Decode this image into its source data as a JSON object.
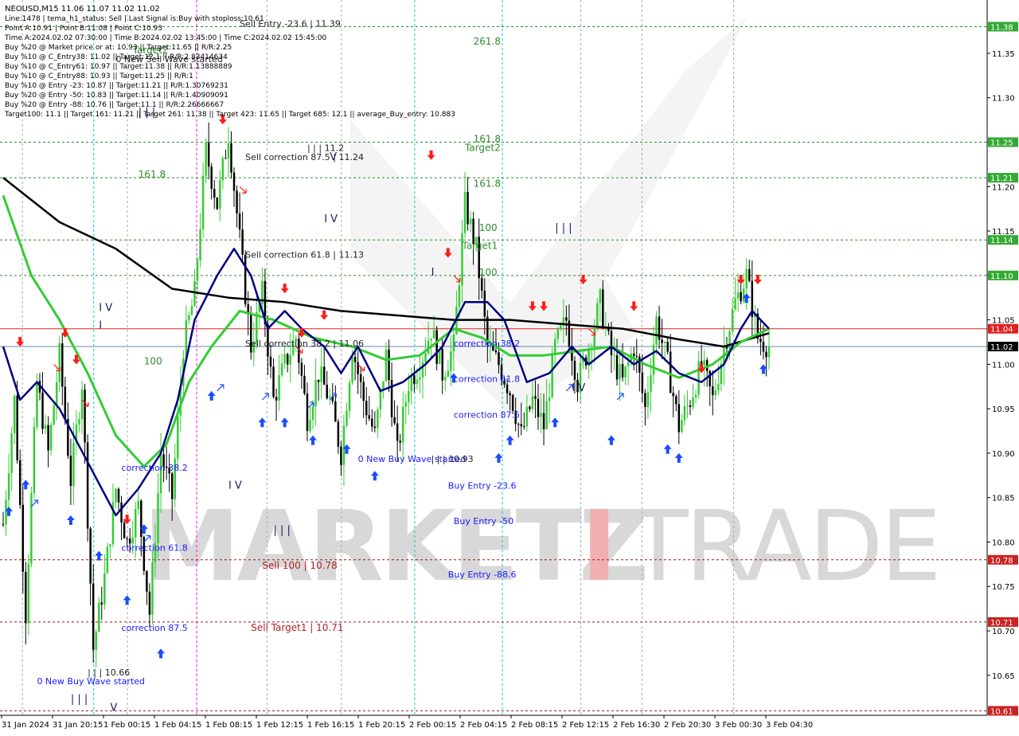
{
  "header": {
    "line1": "NEOUSD,M15  11.06 11.07 11.02 11.02",
    "info_lines": [
      "Line:1478 | tema_h1_status: Sell | Last Signal is:Buy with stoploss:10.61",
      "Point A:10.91 | Point B:11.08 | Point C:10.93",
      "Time A:2024.02.02 07:30:00 | Time B:2024.02.02 13:45:00 | Time C:2024.02.02 15:45:00",
      "Buy %20 @ Market price or at: 10.93 || Target:11.65 || R/R:2.25",
      "Buy %10 @ C_Entry38: 11.02 || Target:12.1 || R/R:2.83414634",
      "Buy %10 @ C_Entry61: 10.97 || Target:11.38 || R/R:1.13888889",
      "Buy %10 @ C_Entry88: 10.93 || Target:11.25 || R/R:1",
      "Buy %10 @ Entry -23: 10.87 || Target:11.21 || R/R:1.30769231",
      "Buy %20 @ Entry -50: 10.83 || Target:11.14 || R/R:1.40909091",
      "Buy %20 @ Entry -88: 10.76 || Target:11.1 || R/R:2.26666667",
      "Target100: 11.1 || Target 161: 11.21 || Target 261: 11.38 || Target 423: 11.65 || Target 685: 12.1 || average_Buy_entry: 10.883"
    ]
  },
  "watermark": {
    "left": "MARKETZ",
    "mid": "I",
    "right": "TRADE"
  },
  "colors": {
    "background": "#ffffff",
    "bull": "#33cc33",
    "bear": "#000000",
    "green_dashed": "#2e8b2e",
    "red_dashed": "#9b1b1b",
    "cyan_vline": "#00cccc",
    "magenta_vline": "#ff00ff",
    "gray_vline": "#aaaaaa",
    "current_line": "#e02020",
    "bid_line": "#6a8aa8",
    "ma_black": "#000000",
    "ma_green": "#33cc33",
    "ma_navy": "#000080",
    "buy_arrow": "#1a4cff",
    "sell_arrow": "#ff1a1a",
    "label_green": "#2e8b2e",
    "label_red": "#b22222",
    "label_blue": "#1a1aff",
    "watermark": "#d8d8d8",
    "watermark_red": "#f0b0b0"
  },
  "chart_data": {
    "type": "candlestick",
    "symbol": "NEOUSD",
    "timeframe": "M15",
    "ylim": [
      10.605,
      11.41
    ],
    "current_price": 11.04,
    "bid_price": 11.02,
    "price_ticks": [
      "11.35",
      "11.30",
      "11.25",
      "11.20",
      "11.15",
      "11.10",
      "11.05",
      "11.00",
      "10.95",
      "10.90",
      "10.85",
      "10.80",
      "10.75",
      "10.70",
      "10.65"
    ],
    "time_ticks": [
      "31 Jan 2024",
      "31 Jan 20:15",
      "1 Feb 00:15",
      "1 Feb 04:15",
      "1 Feb 08:15",
      "1 Feb 12:15",
      "1 Feb 16:15",
      "1 Feb 20:15",
      "2 Feb 00:15",
      "2 Feb 04:15",
      "2 Feb 08:15",
      "2 Feb 12:15",
      "2 Feb 16:30",
      "2 Feb 20:30",
      "3 Feb 00:30",
      "3 Feb 04:30"
    ],
    "level_lines": [
      {
        "price": 11.38,
        "label": "11.38",
        "kind": "green"
      },
      {
        "price": 11.25,
        "label": "11.25",
        "kind": "green"
      },
      {
        "price": 11.21,
        "label": "11.21",
        "kind": "green"
      },
      {
        "price": 11.14,
        "label": "11.14",
        "kind": "green"
      },
      {
        "price": 11.1,
        "label": "11.10",
        "kind": "green"
      },
      {
        "price": 10.78,
        "label": "10.78",
        "kind": "red"
      },
      {
        "price": 10.71,
        "label": "10.71",
        "kind": "red"
      },
      {
        "price": 10.61,
        "label": "10.61",
        "kind": "red"
      }
    ],
    "vlines": [
      {
        "x_frac": 0.022,
        "kind": "gray"
      },
      {
        "x_frac": 0.092,
        "kind": "cyan"
      },
      {
        "x_frac": 0.125,
        "kind": "gray"
      },
      {
        "x_frac": 0.193,
        "kind": "magenta"
      },
      {
        "x_frac": 0.262,
        "kind": "gray"
      },
      {
        "x_frac": 0.335,
        "kind": "gray"
      },
      {
        "x_frac": 0.407,
        "kind": "cyan"
      },
      {
        "x_frac": 0.493,
        "kind": "cyan"
      },
      {
        "x_frac": 0.57,
        "kind": "gray"
      },
      {
        "x_frac": 0.63,
        "kind": "gray"
      },
      {
        "x_frac": 0.72,
        "kind": "gray"
      }
    ],
    "anchors": [
      [
        0,
        10.82
      ],
      [
        4,
        10.96
      ],
      [
        8,
        10.72
      ],
      [
        12,
        10.98
      ],
      [
        16,
        10.9
      ],
      [
        20,
        11.01
      ],
      [
        24,
        10.87
      ],
      [
        28,
        10.98
      ],
      [
        32,
        10.68
      ],
      [
        36,
        10.76
      ],
      [
        40,
        10.86
      ],
      [
        44,
        10.8
      ],
      [
        48,
        10.84
      ],
      [
        52,
        10.72
      ],
      [
        56,
        10.9
      ],
      [
        60,
        10.85
      ],
      [
        64,
        11.02
      ],
      [
        68,
        11.08
      ],
      [
        72,
        11.24
      ],
      [
        76,
        11.18
      ],
      [
        80,
        11.26
      ],
      [
        84,
        11.14
      ],
      [
        88,
        11.02
      ],
      [
        92,
        11.08
      ],
      [
        96,
        10.96
      ],
      [
        100,
        11.0
      ],
      [
        104,
        11.03
      ],
      [
        108,
        10.94
      ],
      [
        112,
        10.99
      ],
      [
        116,
        10.96
      ],
      [
        120,
        10.9
      ],
      [
        124,
        11.02
      ],
      [
        128,
        10.96
      ],
      [
        132,
        10.92
      ],
      [
        136,
        11.01
      ],
      [
        140,
        10.9
      ],
      [
        144,
        10.98
      ],
      [
        148,
        11.0
      ],
      [
        152,
        11.04
      ],
      [
        156,
        10.99
      ],
      [
        160,
        11.02
      ],
      [
        164,
        11.18
      ],
      [
        168,
        11.13
      ],
      [
        172,
        11.02
      ],
      [
        176,
        11.0
      ],
      [
        180,
        10.97
      ],
      [
        184,
        10.92
      ],
      [
        188,
        10.96
      ],
      [
        192,
        10.93
      ],
      [
        196,
        11.02
      ],
      [
        200,
        11.05
      ],
      [
        204,
        10.98
      ],
      [
        208,
        11.02
      ],
      [
        212,
        11.07
      ],
      [
        216,
        11.01
      ],
      [
        220,
        10.98
      ],
      [
        224,
        11.02
      ],
      [
        228,
        10.95
      ],
      [
        232,
        11.05
      ],
      [
        236,
        11.0
      ],
      [
        240,
        10.93
      ],
      [
        244,
        10.96
      ],
      [
        248,
        11.0
      ],
      [
        252,
        10.96
      ],
      [
        256,
        11.02
      ],
      [
        260,
        11.07
      ],
      [
        264,
        11.1
      ],
      [
        268,
        11.03
      ],
      [
        272,
        11.02
      ]
    ],
    "ma_black": [
      [
        0,
        11.21
      ],
      [
        20,
        11.16
      ],
      [
        40,
        11.13
      ],
      [
        60,
        11.085
      ],
      [
        80,
        11.075
      ],
      [
        100,
        11.07
      ],
      [
        120,
        11.06
      ],
      [
        140,
        11.055
      ],
      [
        160,
        11.05
      ],
      [
        180,
        11.05
      ],
      [
        200,
        11.045
      ],
      [
        220,
        11.04
      ],
      [
        240,
        11.028
      ],
      [
        256,
        11.02
      ],
      [
        272,
        11.035
      ]
    ],
    "ma_green": [
      [
        0,
        11.19
      ],
      [
        10,
        11.1
      ],
      [
        20,
        11.05
      ],
      [
        30,
        10.99
      ],
      [
        40,
        10.92
      ],
      [
        50,
        10.885
      ],
      [
        58,
        10.91
      ],
      [
        66,
        10.98
      ],
      [
        74,
        11.02
      ],
      [
        84,
        11.06
      ],
      [
        96,
        11.05
      ],
      [
        110,
        11.03
      ],
      [
        124,
        11.02
      ],
      [
        136,
        11.005
      ],
      [
        148,
        11.01
      ],
      [
        160,
        11.04
      ],
      [
        170,
        11.03
      ],
      [
        180,
        11.01
      ],
      [
        192,
        11.01
      ],
      [
        204,
        11.015
      ],
      [
        216,
        11.02
      ],
      [
        228,
        11.0
      ],
      [
        240,
        10.985
      ],
      [
        252,
        11.0
      ],
      [
        262,
        11.025
      ],
      [
        272,
        11.04
      ]
    ],
    "ma_navy": [
      [
        0,
        11.02
      ],
      [
        6,
        10.96
      ],
      [
        12,
        10.98
      ],
      [
        20,
        10.95
      ],
      [
        30,
        10.89
      ],
      [
        40,
        10.83
      ],
      [
        48,
        10.86
      ],
      [
        56,
        10.9
      ],
      [
        62,
        10.96
      ],
      [
        68,
        11.05
      ],
      [
        76,
        11.1
      ],
      [
        82,
        11.13
      ],
      [
        88,
        11.1
      ],
      [
        94,
        11.04
      ],
      [
        100,
        11.06
      ],
      [
        106,
        11.04
      ],
      [
        114,
        11.02
      ],
      [
        120,
        10.99
      ],
      [
        126,
        11.02
      ],
      [
        134,
        10.97
      ],
      [
        142,
        10.98
      ],
      [
        150,
        11.0
      ],
      [
        156,
        11.02
      ],
      [
        164,
        11.07
      ],
      [
        172,
        11.07
      ],
      [
        178,
        11.05
      ],
      [
        186,
        10.98
      ],
      [
        194,
        10.99
      ],
      [
        202,
        11.02
      ],
      [
        208,
        11.0
      ],
      [
        216,
        11.02
      ],
      [
        224,
        11.0
      ],
      [
        232,
        11.015
      ],
      [
        240,
        10.99
      ],
      [
        248,
        10.98
      ],
      [
        256,
        11.0
      ],
      [
        262,
        11.04
      ],
      [
        266,
        11.06
      ],
      [
        272,
        11.04
      ]
    ],
    "buy_arrows": [
      [
        2,
        10.84
      ],
      [
        8,
        10.87
      ],
      [
        24,
        10.83
      ],
      [
        34,
        10.79
      ],
      [
        44,
        10.74
      ],
      [
        50,
        10.82
      ],
      [
        56,
        10.68
      ],
      [
        74,
        10.97
      ],
      [
        92,
        10.94
      ],
      [
        100,
        10.94
      ],
      [
        110,
        10.92
      ],
      [
        122,
        10.91
      ],
      [
        132,
        10.88
      ],
      [
        160,
        10.99
      ],
      [
        176,
        10.9
      ],
      [
        180,
        10.92
      ],
      [
        196,
        10.94
      ],
      [
        216,
        10.92
      ],
      [
        236,
        10.91
      ],
      [
        240,
        10.9
      ],
      [
        264,
        11.08
      ],
      [
        270,
        11.0
      ]
    ],
    "sell_arrows": [
      [
        6,
        11.02
      ],
      [
        22,
        11.03
      ],
      [
        26,
        11.0
      ],
      [
        44,
        10.82
      ],
      [
        78,
        11.27
      ],
      [
        100,
        11.08
      ],
      [
        106,
        11.03
      ],
      [
        114,
        11.05
      ],
      [
        152,
        11.23
      ],
      [
        158,
        11.12
      ],
      [
        188,
        11.06
      ],
      [
        192,
        11.06
      ],
      [
        206,
        11.09
      ],
      [
        224,
        11.06
      ],
      [
        248,
        10.99
      ],
      [
        262,
        11.09
      ],
      [
        268,
        11.09
      ]
    ],
    "hollow_buy_arrows": [
      [
        10,
        10.84
      ],
      [
        50,
        10.8
      ],
      [
        76,
        10.97
      ],
      [
        92,
        10.96
      ],
      [
        108,
        10.95
      ],
      [
        116,
        10.96
      ],
      [
        200,
        10.97
      ],
      [
        218,
        10.96
      ]
    ],
    "hollow_sell_arrows": [
      [
        18,
        11.0
      ],
      [
        28,
        10.96
      ],
      [
        84,
        11.2
      ],
      [
        104,
        11.02
      ],
      [
        126,
        11.0
      ],
      [
        160,
        11.1
      ],
      [
        208,
        11.04
      ]
    ],
    "annotations_blue": [
      {
        "text": "correction 38.2",
        "x": 42,
        "price": 10.88
      },
      {
        "text": "correction 61.8",
        "x": 42,
        "price": 10.79
      },
      {
        "text": "correction 87.5",
        "x": 42,
        "price": 10.7
      },
      {
        "text": "0 New Buy Wave started",
        "x": 12,
        "price": 10.64
      },
      {
        "text": "0 New Buy Wave started",
        "x": 126,
        "price": 10.89
      },
      {
        "text": "correction 38.2",
        "x": 160,
        "price": 11.02
      },
      {
        "text": "correction 61.8",
        "x": 160,
        "price": 10.98
      },
      {
        "text": "correction 87.5",
        "x": 160,
        "price": 10.94
      },
      {
        "text": "Buy Entry -23.6",
        "x": 158,
        "price": 10.86
      },
      {
        "text": "Buy Entry -50",
        "x": 160,
        "price": 10.82
      },
      {
        "text": "Buy Entry -88.6",
        "x": 158,
        "price": 10.76
      }
    ],
    "annotations_green": [
      {
        "text": "261.8",
        "x": 167,
        "price": 11.36
      },
      {
        "text": "161.8",
        "x": 167,
        "price": 11.25
      },
      {
        "text": "Target2",
        "x": 164,
        "price": 11.24
      },
      {
        "text": "161.8",
        "x": 167,
        "price": 11.2
      },
      {
        "text": "100",
        "x": 169,
        "price": 11.15
      },
      {
        "text": "Target1",
        "x": 163,
        "price": 11.13
      },
      {
        "text": "100",
        "x": 169,
        "price": 11.1
      },
      {
        "text": "161.8",
        "x": 48,
        "price": 11.21
      },
      {
        "text": "100",
        "x": 50,
        "price": 11.0
      },
      {
        "text": "Target2",
        "x": 46,
        "price": 11.35
      }
    ],
    "annotations_dark": [
      {
        "text": "Sell Entry -23.6 | 11.39",
        "x": 84,
        "price": 11.38
      },
      {
        "text": "Sell correction 87.5 | 11.24",
        "x": 86,
        "price": 11.23
      },
      {
        "text": "Sell correction 61.8 | 11.13",
        "x": 86,
        "price": 11.12
      },
      {
        "text": "Sell correction 38.2 | 11.06",
        "x": 86,
        "price": 11.02
      },
      {
        "text": "| | | 11.2",
        "x": 108,
        "price": 11.24
      },
      {
        "text": "| | | 10.93",
        "x": 152,
        "price": 10.89
      },
      {
        "text": "| | | 10.66",
        "x": 30,
        "price": 10.65
      },
      {
        "text": "0 New Sell Wave started",
        "x": 40,
        "price": 11.34
      }
    ],
    "annotations_red": [
      {
        "text": "Sell 100 | 10.78",
        "x": 92,
        "price": 10.77
      },
      {
        "text": "Sell Target1 | 10.71",
        "x": 88,
        "price": 10.7
      }
    ],
    "wave_labels": [
      {
        "text": "| | |",
        "x": 48,
        "price": 11.28
      },
      {
        "text": "I V",
        "x": 34,
        "price": 11.06
      },
      {
        "text": "I",
        "x": 34,
        "price": 11.04
      },
      {
        "text": "I V",
        "x": 80,
        "price": 10.86
      },
      {
        "text": "| | |",
        "x": 96,
        "price": 10.81
      },
      {
        "text": "I V",
        "x": 114,
        "price": 11.16
      },
      {
        "text": "V",
        "x": 116,
        "price": 11.23
      },
      {
        "text": "I",
        "x": 152,
        "price": 11.1
      },
      {
        "text": "| | |",
        "x": 196,
        "price": 11.15
      },
      {
        "text": "I V",
        "x": 202,
        "price": 10.97
      },
      {
        "text": "| | |",
        "x": 24,
        "price": 10.62
      },
      {
        "text": "V",
        "x": 38,
        "price": 10.61
      }
    ]
  }
}
